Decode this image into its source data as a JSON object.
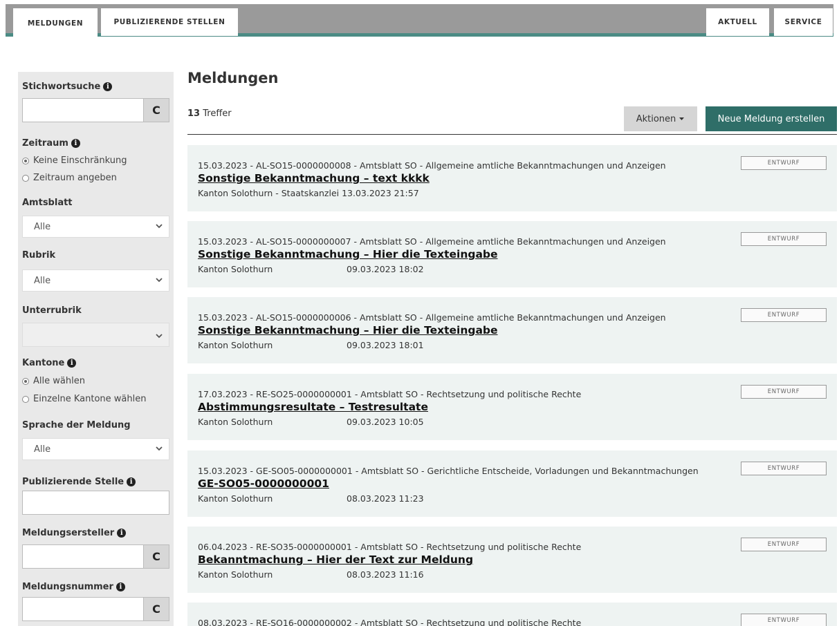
{
  "nav": {
    "left_tabs": [
      "MELDUNGEN",
      "PUBLIZIERENDE STELLEN"
    ],
    "right_tabs": [
      "AKTUELL",
      "SERVICE"
    ],
    "active_tab": "MELDUNGEN"
  },
  "sidebar": {
    "keyword_label": "Stichwortsuche",
    "period_label": "Zeitraum",
    "period_options": [
      "Keine Einschränkung",
      "Zeitraum angeben"
    ],
    "gazette_label": "Amtsblatt",
    "gazette_value": "Alle",
    "rubric_label": "Rubrik",
    "rubric_value": "Alle",
    "subrubric_label": "Unterrubrik",
    "subrubric_value": "",
    "cantons_label": "Kantone",
    "canton_options": [
      "Alle wählen",
      "Einzelne Kantone wählen"
    ],
    "language_label": "Sprache der Meldung",
    "language_value": "Alle",
    "publisher_label": "Publizierende Stelle",
    "creator_label": "Meldungsersteller",
    "number_label": "Meldungsnummer",
    "refresh_glyph": "C"
  },
  "main": {
    "title": "Meldungen",
    "hit_count": "13",
    "hit_label": "Treffer",
    "actions_label": "Aktionen",
    "new_button_label": "Neue Meldung erstellen"
  },
  "results": [
    {
      "meta": "15.03.2023 - AL-SO15-0000000008 - Amtsblatt SO - Allgemeine amtliche Bekanntmachungen und Anzeigen",
      "title": "Sonstige Bekanntmachung – text kkkk",
      "author": "Kanton Solothurn - Staatskanzlei 13.03.2023 21:57",
      "date": "",
      "status": "ENTWURF"
    },
    {
      "meta": "15.03.2023 - AL-SO15-0000000007 - Amtsblatt SO - Allgemeine amtliche Bekanntmachungen und Anzeigen",
      "title": "Sonstige Bekanntmachung – Hier die Texteingabe",
      "author": "Kanton Solothurn",
      "date": "09.03.2023 18:02",
      "status": "ENTWURF"
    },
    {
      "meta": "15.03.2023 - AL-SO15-0000000006 - Amtsblatt SO - Allgemeine amtliche Bekanntmachungen und Anzeigen",
      "title": "Sonstige Bekanntmachung – Hier die Texteingabe",
      "author": "Kanton Solothurn",
      "date": "09.03.2023 18:01",
      "status": "ENTWURF"
    },
    {
      "meta": "17.03.2023 - RE-SO25-0000000001 - Amtsblatt SO - Rechtsetzung und politische Rechte",
      "title": "Abstimmungsresultate – Testresultate",
      "author": "Kanton Solothurn",
      "date": "09.03.2023 10:05",
      "status": "ENTWURF"
    },
    {
      "meta": "15.03.2023 - GE-SO05-0000000001 - Amtsblatt SO - Gerichtliche Entscheide, Vorladungen und Bekanntmachungen",
      "title": "GE-SO05-0000000001",
      "author": "Kanton Solothurn",
      "date": "08.03.2023 11:23",
      "status": "ENTWURF"
    },
    {
      "meta": "06.04.2023 - RE-SO35-0000000001 - Amtsblatt SO - Rechtsetzung und politische Rechte",
      "title": "Bekanntmachung – Hier der Text zur Meldung",
      "author": "Kanton Solothurn",
      "date": "08.03.2023 11:16",
      "status": "ENTWURF"
    },
    {
      "meta": "08.03.2023 - RE-SO16-0000000002 - Amtsblatt SO - Rechtsetzung und politische Rechte",
      "title": "",
      "author": "",
      "date": "",
      "status": "ENTWURF"
    }
  ]
}
